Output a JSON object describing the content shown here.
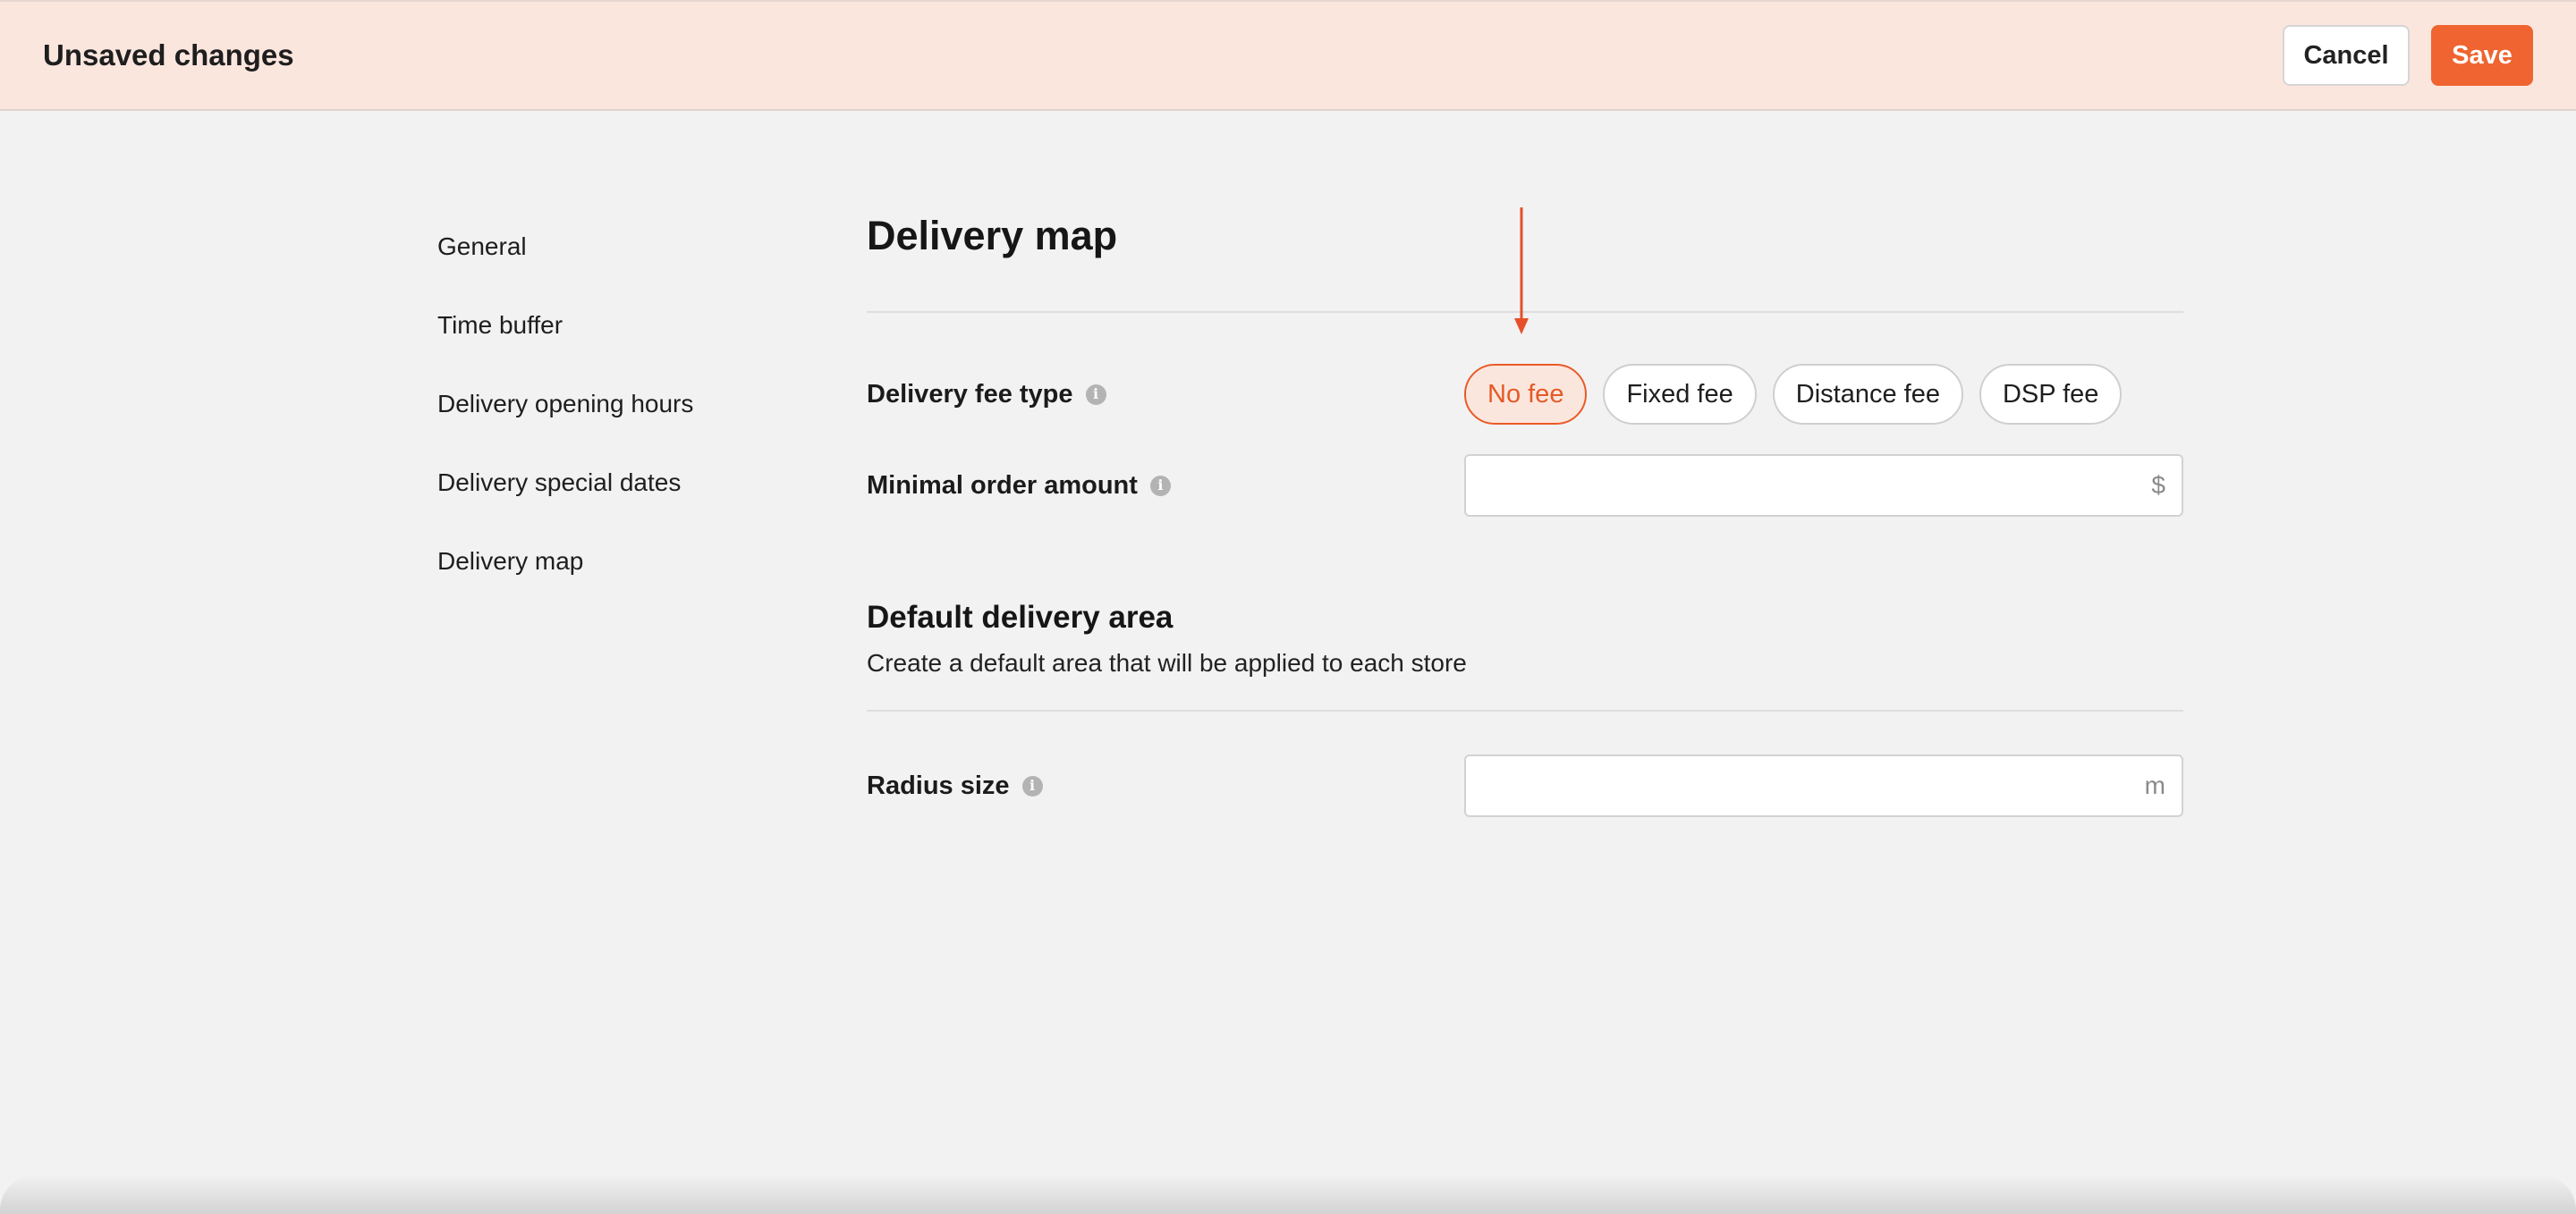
{
  "topbar": {
    "title": "Unsaved changes",
    "cancel_label": "Cancel",
    "save_label": "Save"
  },
  "sidenav": {
    "items": [
      {
        "label": "General"
      },
      {
        "label": "Time buffer"
      },
      {
        "label": "Delivery opening hours"
      },
      {
        "label": "Delivery special dates"
      },
      {
        "label": "Delivery map"
      }
    ]
  },
  "main": {
    "title": "Delivery map",
    "delivery_fee": {
      "label": "Delivery fee type",
      "options": [
        "No fee",
        "Fixed fee",
        "Distance fee",
        "DSP fee"
      ],
      "selected": "No fee"
    },
    "minimal_order": {
      "label": "Minimal order amount",
      "value": "",
      "suffix": "$"
    },
    "default_area": {
      "title": "Default delivery area",
      "description": "Create a default area that will be applied to each store"
    },
    "radius": {
      "label": "Radius size",
      "value": "",
      "suffix": "m"
    }
  },
  "icons": {
    "info": "i"
  },
  "colors": {
    "accent": "#ef6430",
    "banner_bg": "#fbe6de",
    "page_bg": "#f2f2f2",
    "annotation": "#e5502a"
  }
}
